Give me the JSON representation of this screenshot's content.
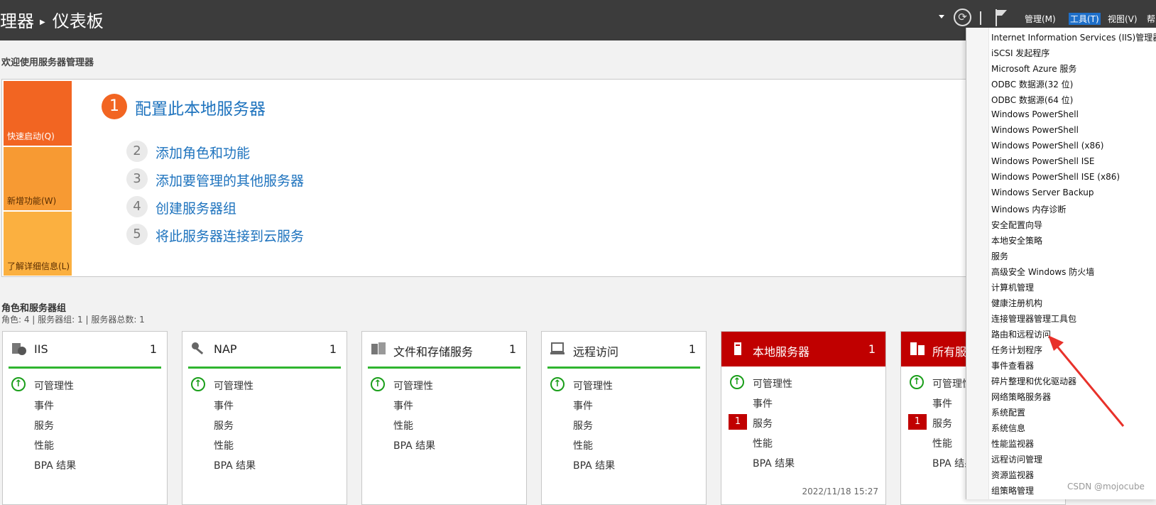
{
  "header": {
    "title_partial": "理器",
    "page_title": "仪表板",
    "menus": [
      {
        "label": "管理(M)",
        "active": false
      },
      {
        "label": "工具(T)",
        "active": true
      },
      {
        "label": "视图(V)",
        "active": false
      },
      {
        "label": "帮",
        "active": false
      }
    ]
  },
  "welcome": {
    "title": "欢迎使用服务器管理器",
    "tiles": [
      "快速启动(Q)",
      "新增功能(W)",
      "了解详细信息(L)"
    ],
    "main_step": {
      "num": "1",
      "label": "配置此本地服务器"
    },
    "steps": [
      {
        "num": "2",
        "label": "添加角色和功能"
      },
      {
        "num": "3",
        "label": "添加要管理的其他服务器"
      },
      {
        "num": "4",
        "label": "创建服务器组"
      },
      {
        "num": "5",
        "label": "将此服务器连接到云服务"
      }
    ]
  },
  "roles": {
    "title": "角色和服务器组",
    "summary": "角色: 4 | 服务器组: 1 | 服务器总数: 1",
    "cards": [
      {
        "title": "IIS",
        "count": "1",
        "rows": [
          {
            "label": "可管理性",
            "status": "ok"
          },
          {
            "label": "事件"
          },
          {
            "label": "服务"
          },
          {
            "label": "性能"
          },
          {
            "label": "BPA 结果"
          }
        ]
      },
      {
        "title": "NAP",
        "count": "1",
        "rows": [
          {
            "label": "可管理性",
            "status": "ok"
          },
          {
            "label": "事件"
          },
          {
            "label": "服务"
          },
          {
            "label": "性能"
          },
          {
            "label": "BPA 结果"
          }
        ]
      },
      {
        "title": "文件和存储服务",
        "count": "1",
        "rows": [
          {
            "label": "可管理性",
            "status": "ok"
          },
          {
            "label": "事件"
          },
          {
            "label": "性能"
          },
          {
            "label": "BPA 结果"
          }
        ]
      },
      {
        "title": "远程访问",
        "count": "1",
        "rows": [
          {
            "label": "可管理性",
            "status": "ok"
          },
          {
            "label": "事件"
          },
          {
            "label": "服务"
          },
          {
            "label": "性能"
          },
          {
            "label": "BPA 结果"
          }
        ]
      },
      {
        "title": "本地服务器",
        "count": "1",
        "red": true,
        "timestamp": "2022/11/18 15:27",
        "rows": [
          {
            "label": "可管理性",
            "status": "ok"
          },
          {
            "label": "事件"
          },
          {
            "label": "服务",
            "badge": "1"
          },
          {
            "label": "性能"
          },
          {
            "label": "BPA 结果"
          }
        ]
      },
      {
        "title": "所有服务",
        "count": "",
        "red": true,
        "rows": [
          {
            "label": "可管理性",
            "status": "ok"
          },
          {
            "label": "事件"
          },
          {
            "label": "服务",
            "badge": "1"
          },
          {
            "label": "性能"
          },
          {
            "label": "BPA 结果"
          }
        ]
      }
    ]
  },
  "tools_menu": {
    "items": [
      "Internet Information Services (IIS)管理器",
      "iSCSI 发起程序",
      "Microsoft Azure 服务",
      "ODBC 数据源(32 位)",
      "ODBC 数据源(64 位)",
      "Windows PowerShell",
      "Windows PowerShell",
      "Windows PowerShell (x86)",
      "Windows PowerShell ISE",
      "Windows PowerShell ISE (x86)",
      "Windows Server Backup",
      "Windows 内存诊断",
      "安全配置向导",
      "本地安全策略",
      "服务",
      "高级安全 Windows 防火墙",
      "计算机管理",
      "健康注册机构",
      "连接管理器管理工具包",
      "路由和远程访问",
      "任务计划程序",
      "事件查看器",
      "碎片整理和优化驱动器",
      "网络策略服务器",
      "系统配置",
      "系统信息",
      "性能监视器",
      "远程访问管理",
      "资源监视器",
      "组策略管理"
    ]
  },
  "watermark": "CSDN @mojocube",
  "colors": {
    "accent_orange": "#f26522",
    "link_blue": "#1e73be",
    "alert_red": "#c00000",
    "ok_green": "#2fb52f"
  }
}
